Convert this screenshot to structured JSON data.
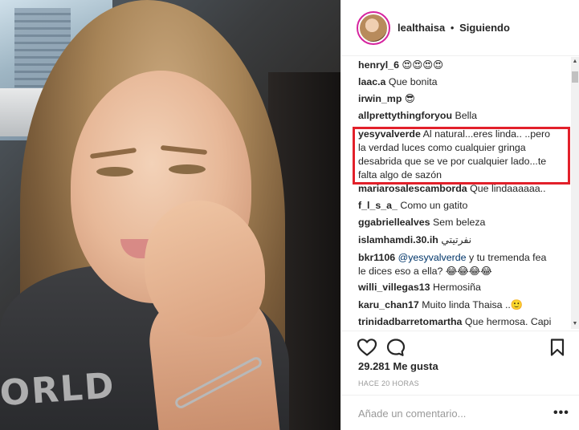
{
  "post": {
    "username": "lealthaisa",
    "separator": "•",
    "follow_status": "Siguiendo",
    "likes": "29.281 Me gusta",
    "time": "HACE 20 HORAS",
    "comment_placeholder": "Añade un comentario...",
    "more_label": "•••",
    "photo_text": "ORLD"
  },
  "comments": [
    {
      "user": "henryl_6",
      "text": "😍😍😍😍"
    },
    {
      "user": "laac.a",
      "text": "Que bonita"
    },
    {
      "user": "irwin_mp",
      "text": "😎"
    },
    {
      "user": "allprettythingforyou",
      "text": "Bella"
    },
    {
      "user": "yesyvalverde",
      "text": "Al natural...eres linda.. ..pero la verdad luces como cualquier gringa desabrida que se ve por cualquier lado...te falta algo de sazón"
    },
    {
      "user": "mariarosalescamborda",
      "text": "Que lindaaaaaa.."
    },
    {
      "user": "f_l_s_a_",
      "text": "Como un gatito"
    },
    {
      "user": "ggabriellealves",
      "text": "Sem beleza"
    },
    {
      "user": "islamhamdi.30.ih",
      "text": "نفرتيتي"
    },
    {
      "user": "bkr1106",
      "mention": "@yesyvalverde",
      "text": "y tu tremenda fea le dices eso a ella? 😂😂😂😂"
    },
    {
      "user": "willi_villegas13",
      "text": "Hermosiña"
    },
    {
      "user": "karu_chan17",
      "text": "Muito linda Thaisa ..🙂"
    },
    {
      "user": "trinidadbarretomartha",
      "text": "Que hermosa. Capi"
    }
  ],
  "colors": {
    "highlight_border": "#e2202a",
    "avatar_ring": "#d6249f",
    "mention": "#003569",
    "muted": "#999999"
  },
  "icons": {
    "like": "heart-icon",
    "comment": "speech-bubble-icon",
    "save": "bookmark-icon",
    "more": "ellipsis-icon"
  }
}
